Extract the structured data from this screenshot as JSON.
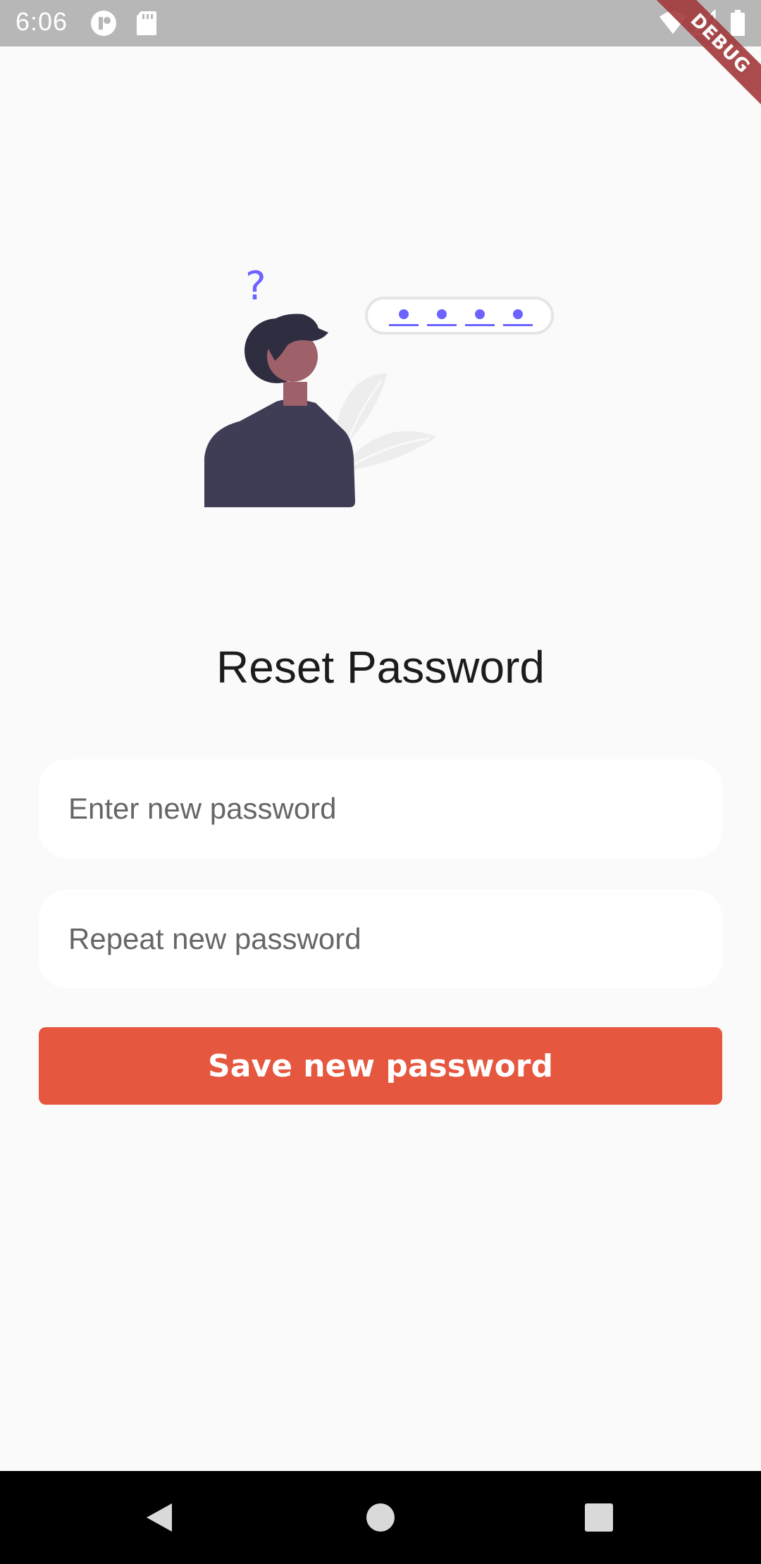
{
  "status_bar": {
    "time": "6:06"
  },
  "debug_ribbon": {
    "label": "DEBUG"
  },
  "illustration": {
    "question_mark": "?"
  },
  "page": {
    "title": "Reset Password"
  },
  "form": {
    "new_password": {
      "placeholder": "Enter new password",
      "value": ""
    },
    "repeat_password": {
      "placeholder": "Repeat new password",
      "value": ""
    },
    "save_label": "Save new password"
  },
  "icons": {
    "status": [
      "app-icon",
      "sd-card-icon",
      "wifi-icon",
      "signal-icon",
      "battery-icon"
    ],
    "nav": [
      "back-icon",
      "home-icon",
      "recents-icon"
    ]
  },
  "colors": {
    "accent": "#e5573f",
    "illustration_accent": "#6c63ff",
    "status_bar": "#b7b7b7",
    "background": "#fafafa",
    "debug": "#a3393c"
  }
}
